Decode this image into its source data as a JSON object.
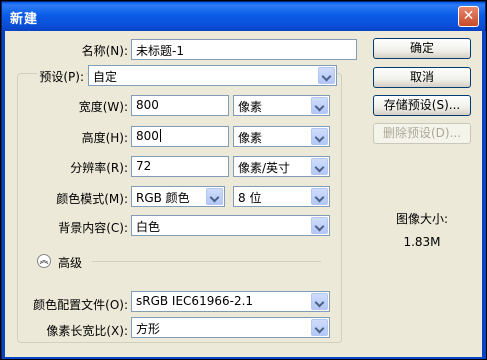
{
  "window": {
    "title": "新建",
    "close_glyph": "✕"
  },
  "name": {
    "label": "名称(N):",
    "value": "未标题-1"
  },
  "preset": {
    "label": "预设(P):",
    "value": "自定"
  },
  "width": {
    "label": "宽度(W):",
    "value": "800",
    "unit": "像素"
  },
  "height": {
    "label": "高度(H):",
    "value": "800",
    "unit": "像素"
  },
  "resolution": {
    "label": "分辨率(R):",
    "value": "72",
    "unit": "像素/英寸"
  },
  "color_mode": {
    "label": "颜色模式(M):",
    "mode": "RGB 颜色",
    "depth": "8 位"
  },
  "background": {
    "label": "背景内容(C):",
    "value": "白色"
  },
  "advanced": {
    "label": "高级"
  },
  "color_profile": {
    "label": "颜色配置文件(O):",
    "value": "sRGB IEC61966-2.1"
  },
  "pixel_aspect": {
    "label": "像素长宽比(X):",
    "value": "方形"
  },
  "buttons": {
    "ok": "确定",
    "cancel": "取消",
    "save_preset": "存储预设(S)...",
    "delete_preset": "删除预设(D)..."
  },
  "image_size": {
    "label": "图像大小:",
    "value": "1.83M"
  }
}
